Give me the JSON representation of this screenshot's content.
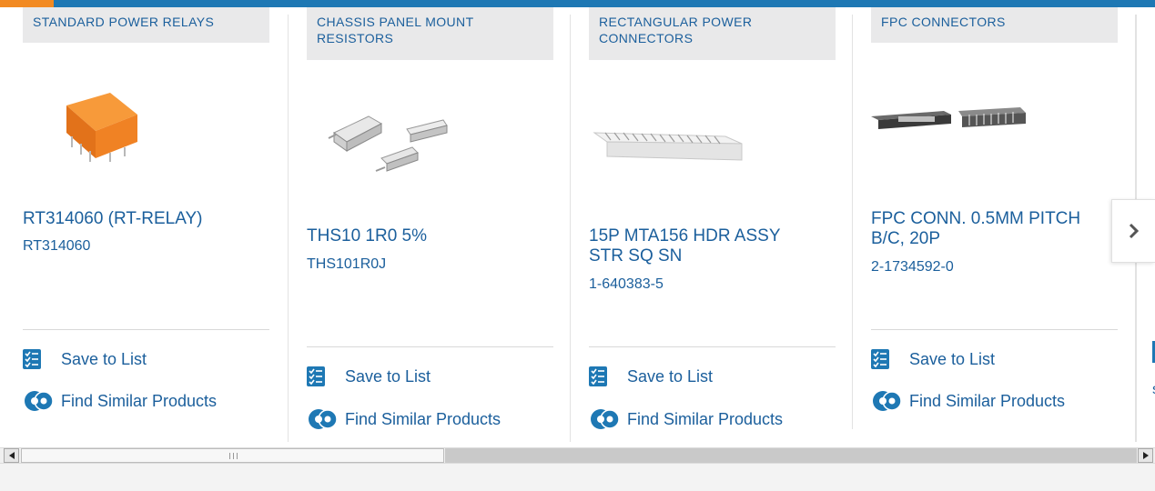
{
  "cards": [
    {
      "category": "STANDARD POWER RELAYS",
      "title": "RT314060 (RT-RELAY)",
      "sku": "RT314060",
      "save_label": "Save to List",
      "similar_label": "Find Similar Products"
    },
    {
      "category": "CHASSIS PANEL MOUNT RESISTORS",
      "title": "THS10 1R0 5%",
      "sku": "THS101R0J",
      "save_label": "Save to List",
      "similar_label": "Find Similar Products"
    },
    {
      "category": "RECTANGULAR POWER CONNECTORS",
      "title": "15P MTA156 HDR ASSY STR SQ SN",
      "sku": "1-640383-5",
      "save_label": "Save to List",
      "similar_label": "Find Similar Products"
    },
    {
      "category": "FPC CONNECTORS",
      "title": "FPC CONN. 0.5MM PITCH B/C, 20P",
      "sku": "2-1734592-0",
      "save_label": "Save to List",
      "similar_label": "Find Similar Products"
    }
  ],
  "peek_text": "s",
  "icons": {
    "save": "list-icon",
    "similar": "gear-icon",
    "next": "chevron-right-icon",
    "scroll_left": "scroll-left-arrow-icon",
    "scroll_right": "scroll-right-arrow-icon"
  },
  "colors": {
    "accent_blue": "#1e78b4",
    "link_blue": "#1b5f9c",
    "accent_orange": "#f28a22",
    "tab_bg": "#e9e9ea"
  }
}
